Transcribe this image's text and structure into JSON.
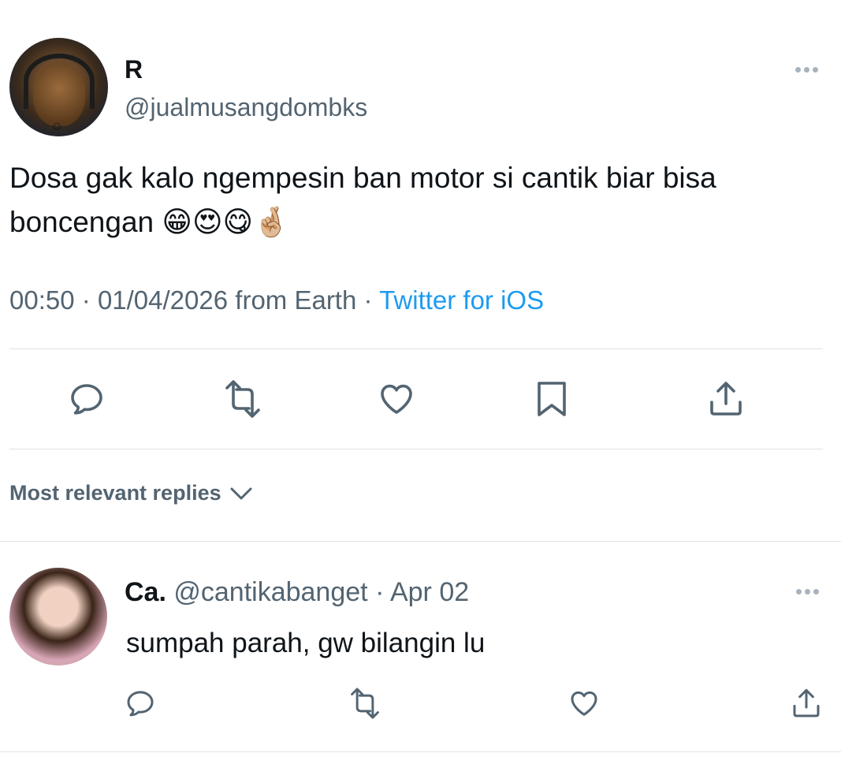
{
  "tweet": {
    "author_name": "R",
    "author_handle": "@jualmusangdombks",
    "text": "Dosa gak kalo ngempesin ban motor si cantik biar bisa boncengan 😁😍😋🤞🏼",
    "time": "00:50",
    "date": "01/04/2026",
    "location": "from Earth",
    "source": "Twitter for iOS",
    "more_icon": "more-horizontal-icon"
  },
  "actions": {
    "icons": [
      "reply-icon",
      "retweet-icon",
      "like-icon",
      "bookmark-icon",
      "share-icon"
    ]
  },
  "replies_section": {
    "sort_label": "Most relevant replies",
    "sort_icon": "chevron-down-icon"
  },
  "replies": [
    {
      "name": "Ca.",
      "handle": "@cantikabanget",
      "date": "Apr 02",
      "text": "sumpah parah, gw bilangin lu"
    }
  ],
  "colors": {
    "text_primary": "#0f1419",
    "text_secondary": "#536471",
    "link": "#1d9bf0",
    "divider": "#dde3e8"
  }
}
